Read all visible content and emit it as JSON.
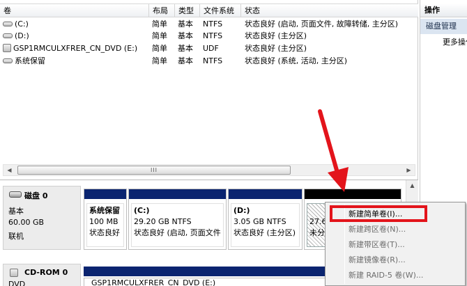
{
  "columns": {
    "volume": "卷",
    "layout": "布局",
    "type": "类型",
    "filesystem": "文件系统",
    "status": "状态"
  },
  "volumes": [
    {
      "name": "(C:)",
      "layout": "简单",
      "type": "基本",
      "fs": "NTFS",
      "status": "状态良好 (启动, 页面文件, 故障转储, 主分区)",
      "icon": "hard-drive-icon"
    },
    {
      "name": "(D:)",
      "layout": "简单",
      "type": "基本",
      "fs": "NTFS",
      "status": "状态良好 (主分区)",
      "icon": "hard-drive-icon"
    },
    {
      "name": "GSP1RMCULXFRER_CN_DVD (E:)",
      "layout": "简单",
      "type": "基本",
      "fs": "UDF",
      "status": "状态良好 (主分区)",
      "icon": "cd-drive-icon"
    },
    {
      "name": "系统保留",
      "layout": "简单",
      "type": "基本",
      "fs": "NTFS",
      "status": "状态良好 (系统, 活动, 主分区)",
      "icon": "hard-drive-icon"
    }
  ],
  "scrollbar": {
    "thumb_grip": "III",
    "left_arrow": "◀",
    "right_arrow": "▶",
    "up_arrow": "▲",
    "down_arrow": "▼"
  },
  "action_pane": {
    "title": "操作",
    "section": "磁盘管理",
    "more": "更多操作"
  },
  "disk0": {
    "name": "磁盘 0",
    "kind": "基本",
    "size": "60.00 GB",
    "state": "联机",
    "partitions": [
      {
        "name": "系统保留",
        "size": "100 MB",
        "status": "状态良好"
      },
      {
        "name": "(C:)",
        "size": "29.20 GB NTFS",
        "status": "状态良好 (启动, 页面文件"
      },
      {
        "name": "(D:)",
        "size": "3.05 GB NTFS",
        "status": "状态良好 (主分区)"
      }
    ],
    "unallocated": {
      "size": "27.6",
      "status": "未分"
    }
  },
  "cdrom": {
    "name": "CD-ROM 0",
    "kind": "DVD",
    "volume_label": "GSP1RMCULXFRER_CN_DVD (E:)"
  },
  "context_menu": {
    "items": [
      {
        "label": "新建简单卷(I)...",
        "enabled": true
      },
      {
        "label": "新建跨区卷(N)...",
        "enabled": false
      },
      {
        "label": "新建带区卷(T)...",
        "enabled": false
      },
      {
        "label": "新建镜像卷(R)...",
        "enabled": false
      },
      {
        "label": "新建 RAID-5 卷(W)...",
        "enabled": false
      }
    ]
  },
  "colors": {
    "partition_bar": "#0a2470",
    "unallocated_bar": "#000000",
    "annotation_red": "#e3141b",
    "selection_blue": "#dbe5f1"
  }
}
